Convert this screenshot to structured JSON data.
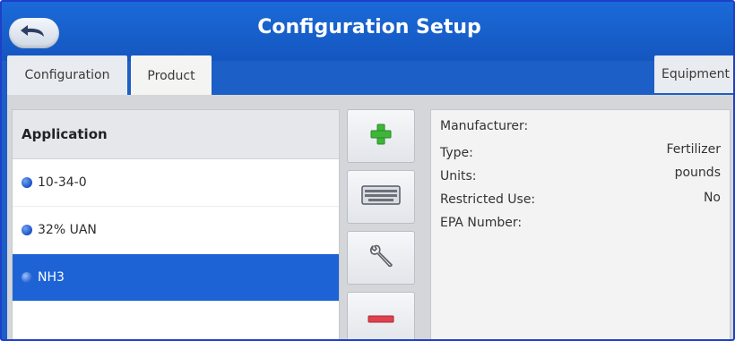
{
  "header": {
    "title": "Configuration Setup"
  },
  "tabs": [
    {
      "label": "Configuration"
    },
    {
      "label": "Product"
    },
    {
      "label": "Equipment"
    }
  ],
  "application_list": {
    "header": "Application",
    "items": [
      {
        "label": "10-34-0",
        "selected": false
      },
      {
        "label": "32% UAN",
        "selected": false
      },
      {
        "label": "NH3",
        "selected": true
      }
    ]
  },
  "tool_buttons": [
    "add-icon",
    "keyboard-icon",
    "wrench-icon",
    "remove-icon"
  ],
  "details": [
    {
      "label": "Manufacturer:",
      "value": ""
    },
    {
      "label": "Type:",
      "value": "Fertilizer"
    },
    {
      "label": "Units:",
      "value": "pounds"
    },
    {
      "label": "Restricted Use:",
      "value": "No"
    },
    {
      "label": "EPA Number:",
      "value": ""
    }
  ],
  "colors": {
    "title_bar": "#1a6ad8",
    "selected_row": "#1d63d6",
    "add_green": "#3fb53a",
    "remove_red": "#e0414f"
  }
}
